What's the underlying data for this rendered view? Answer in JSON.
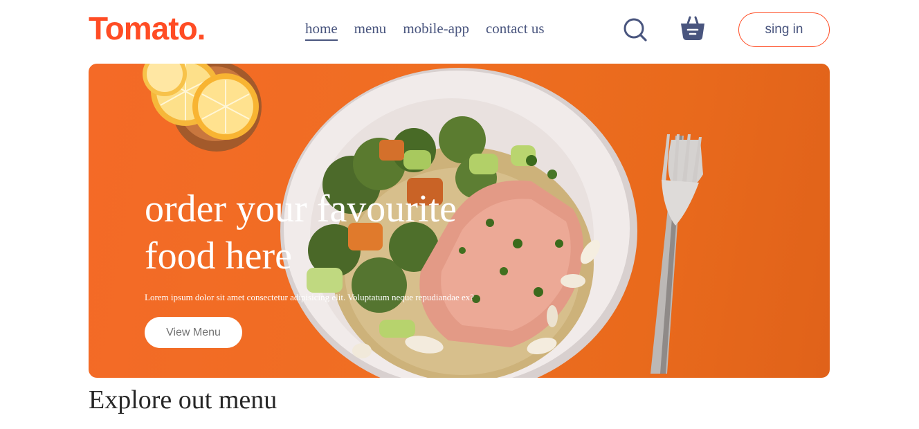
{
  "navbar": {
    "logo": "Tomato.",
    "menu": [
      {
        "label": "home",
        "active": true
      },
      {
        "label": "menu",
        "active": false
      },
      {
        "label": "mobile-app",
        "active": false
      },
      {
        "label": "contact us",
        "active": false
      }
    ],
    "search_icon": "search-icon",
    "basket_icon": "basket-icon",
    "signin_label": "sing in"
  },
  "hero": {
    "title_line1": "order your favourite",
    "title_line2": "food here",
    "description": "Lorem ipsum dolor sit amet consectetur adipisicing elit. Voluptatum neque repudiandae ex?",
    "button_label": "View Menu"
  },
  "explore": {
    "heading": "Explore out menu"
  },
  "colors": {
    "brand": "#ff4c24",
    "nav_text": "#49557e",
    "hero_bg": "#ef6e22"
  }
}
